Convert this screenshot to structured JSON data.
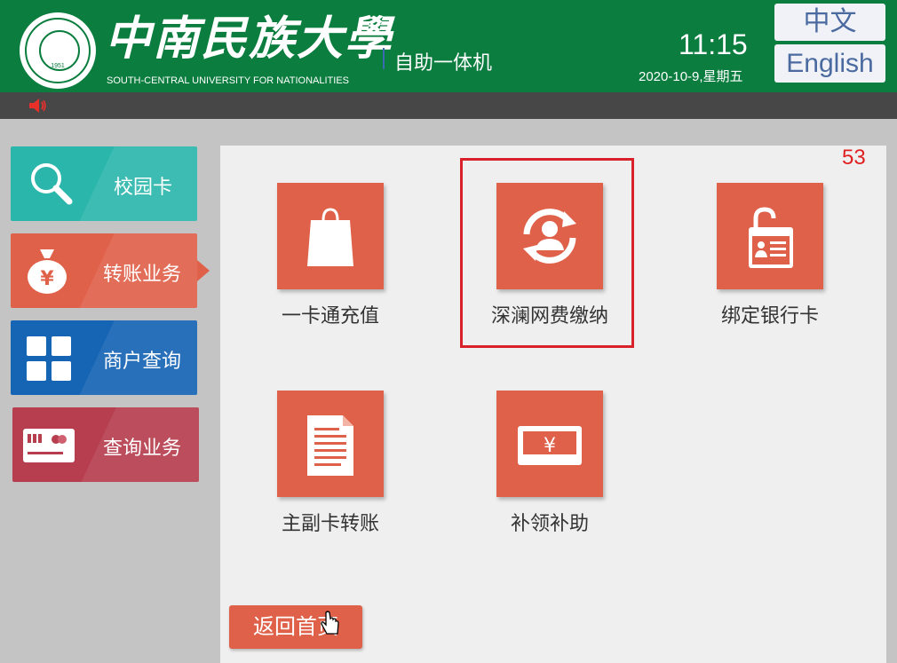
{
  "header": {
    "university_cn": "中南民族大學",
    "university_en": "SOUTH-CENTRAL UNIVERSITY FOR NATIONALITIES",
    "logo_year": "1951",
    "subtitle": "自助一体机",
    "time": "11:15",
    "date": "2020-10-9,星期五",
    "lang_zh": "中文",
    "lang_en": "English",
    "brand_color": "#0b7d3e"
  },
  "toolbar": {
    "speaker_icon": "speaker-icon"
  },
  "sidebar": {
    "items": [
      {
        "label": "校园卡",
        "icon": "search-icon",
        "color": "#2bb6ab"
      },
      {
        "label": "转账业务",
        "icon": "money-bag-icon",
        "color": "#e0614a",
        "active": true
      },
      {
        "label": "商户查询",
        "icon": "grid-icon",
        "color": "#1664b4"
      },
      {
        "label": "查询业务",
        "icon": "bank-card-icon",
        "color": "#b63e4e"
      }
    ]
  },
  "main": {
    "countdown": "53",
    "tiles": [
      {
        "label": "一卡通充值",
        "icon": "shopping-bag-icon"
      },
      {
        "label": "深澜网费缴纳",
        "icon": "user-refresh-icon",
        "highlighted": true
      },
      {
        "label": "绑定银行卡",
        "icon": "unlock-id-card-icon"
      },
      {
        "label": "主副卡转账",
        "icon": "document-icon"
      },
      {
        "label": "补领补助",
        "icon": "yuan-card-icon"
      }
    ],
    "home_button": "返回首页",
    "tile_color": "#e0614a",
    "highlight_color": "#d8212a"
  }
}
